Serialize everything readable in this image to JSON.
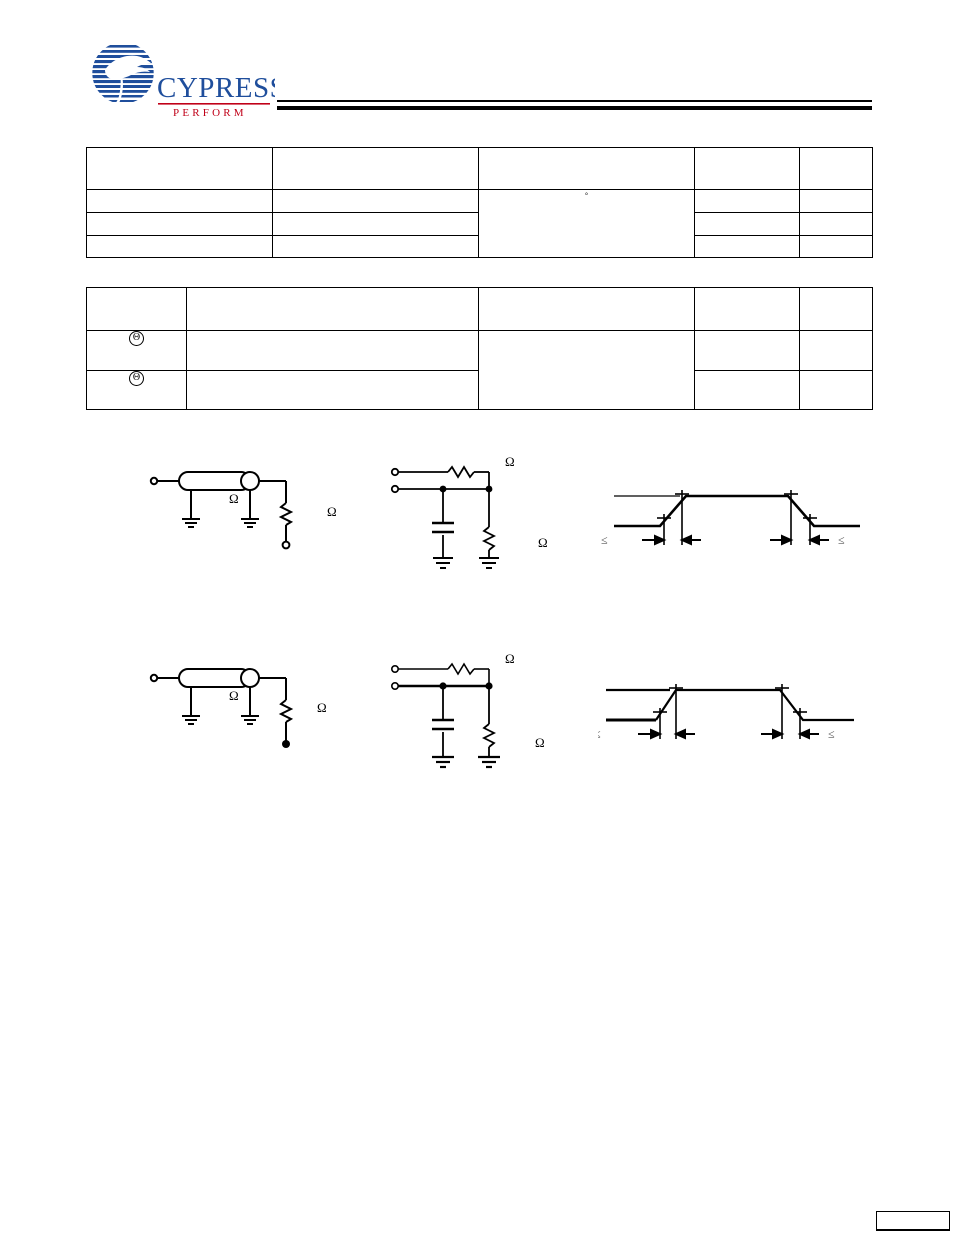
{
  "document": {
    "vendor": "Cypress",
    "logo_wordmark": "CYPRESS",
    "logo_tagline": "PERFORM",
    "brand_blue": "#1F4E9C",
    "brand_red": "#C00018"
  },
  "tables": {
    "table1": {
      "name": "thermal-resistance-table",
      "columns": [
        "",
        "",
        "",
        "",
        ""
      ],
      "rows": [
        {
          "cells": [
            "",
            "",
            "",
            "",
            ""
          ]
        },
        {
          "cells": [
            "",
            "",
            "°",
            "",
            ""
          ]
        },
        {
          "cells": [
            "",
            "",
            "",
            "",
            ""
          ]
        },
        {
          "cells": [
            "",
            "",
            "",
            "",
            ""
          ]
        }
      ],
      "merged_note_symbol": "°"
    },
    "table2": {
      "name": "capacitance-table",
      "columns": [
        "",
        "",
        "",
        "",
        ""
      ],
      "rows": [
        {
          "symbol": "",
          "cells": [
            "",
            "",
            "",
            ""
          ]
        },
        {
          "symbol": "Θ",
          "cells": [
            "",
            "",
            "",
            ""
          ]
        },
        {
          "symbol": "Θ",
          "cells": [
            "",
            "",
            "",
            ""
          ]
        }
      ]
    }
  },
  "figures": {
    "row1": {
      "test_circuit": {
        "name": "ac-test-load-transmission-line-1",
        "labels": [
          "Ω",
          "Ω"
        ]
      },
      "load_circuit": {
        "name": "ac-test-load-equivalent-1",
        "labels": [
          "Ω",
          "Ω"
        ]
      },
      "waveform": {
        "name": "ac-test-input-waveform-1",
        "le_symbols": [
          "≤",
          "≤"
        ]
      }
    },
    "row2": {
      "test_circuit": {
        "name": "ac-test-load-transmission-line-2",
        "labels": [
          "Ω",
          "Ω"
        ]
      },
      "load_circuit": {
        "name": "ac-test-load-equivalent-2",
        "labels": [
          "Ω",
          "Ω"
        ]
      },
      "waveform": {
        "name": "ac-test-input-waveform-2",
        "le_symbols": [
          "≤",
          "≤"
        ]
      }
    }
  },
  "footer": {
    "page_box_text": ""
  }
}
